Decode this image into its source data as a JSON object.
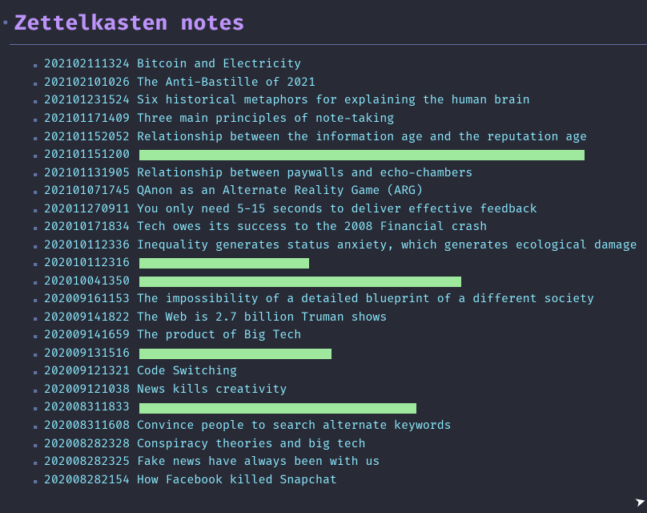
{
  "heading": {
    "marker": "·",
    "title": "Zettelkasten notes"
  },
  "bullet": "▪",
  "notes": [
    {
      "id": "202102111324",
      "title": "Bitcoin and Electricity",
      "redacted": false
    },
    {
      "id": "202102101026",
      "title": "The Anti-Bastille of 2021",
      "redacted": false
    },
    {
      "id": "202101231524",
      "title": "Six historical metaphors for explaining the human brain",
      "redacted": false
    },
    {
      "id": "202101171409",
      "title": "Three main principles of note-taking",
      "redacted": false
    },
    {
      "id": "202101152052",
      "title": "Relationship between the information age and the reputation age",
      "redacted": false
    },
    {
      "id": "202101151200",
      "title": "",
      "redacted": true,
      "redact_width": 556
    },
    {
      "id": "202101131905",
      "title": "Relationship between paywalls and echo-chambers",
      "redacted": false
    },
    {
      "id": "202101071745",
      "title": "QAnon as an Alternate Reality Game (ARG)",
      "redacted": false
    },
    {
      "id": "202011270911",
      "title": "You only need 5-15 seconds to deliver effective feedback",
      "redacted": false
    },
    {
      "id": "202010171834",
      "title": "Tech owes its success to the 2008 Financial crash",
      "redacted": false
    },
    {
      "id": "202010112336",
      "title": "Inequality generates status anxiety, which generates ecological damage",
      "redacted": false
    },
    {
      "id": "202010112316",
      "title": "",
      "redacted": true,
      "redact_width": 212
    },
    {
      "id": "202010041350",
      "title": "",
      "redacted": true,
      "redact_width": 402
    },
    {
      "id": "202009161153",
      "title": "The impossibility of a detailed blueprint of a different society",
      "redacted": false
    },
    {
      "id": "202009141822",
      "title": "The Web is 2.7 billion Truman shows",
      "redacted": false
    },
    {
      "id": "202009141659",
      "title": "The product of Big Tech",
      "redacted": false
    },
    {
      "id": "202009131516",
      "title": "",
      "redacted": true,
      "redact_width": 240
    },
    {
      "id": "202009121321",
      "title": "Code Switching",
      "redacted": false
    },
    {
      "id": "202009121038",
      "title": "News kills creativity",
      "redacted": false
    },
    {
      "id": "202008311833",
      "title": "",
      "redacted": true,
      "redact_width": 346
    },
    {
      "id": "202008311608",
      "title": "Convince people to search alternate keywords",
      "redacted": false
    },
    {
      "id": "202008282328",
      "title": "Conspiracy theories and big tech",
      "redacted": false
    },
    {
      "id": "202008282325",
      "title": "Fake news have always been with us",
      "redacted": false
    },
    {
      "id": "202008282154",
      "title": "How Facebook killed Snapchat",
      "redacted": false
    }
  ]
}
